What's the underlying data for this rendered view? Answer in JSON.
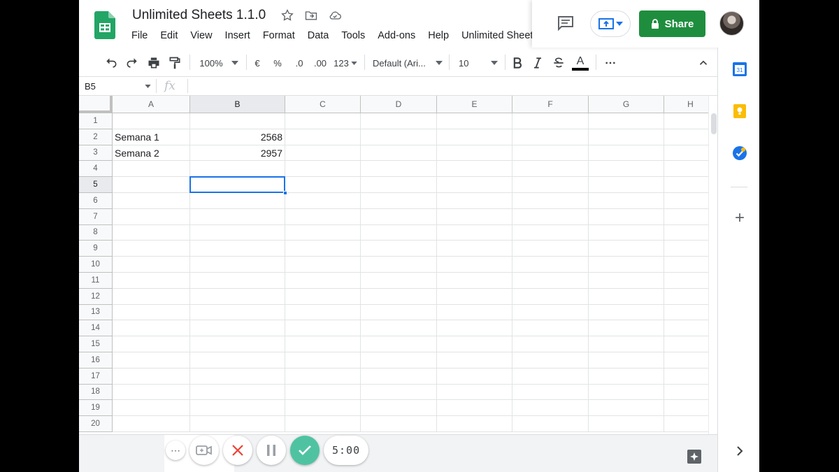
{
  "app": {
    "title": "Unlimited Sheets 1.1.0"
  },
  "menu": [
    "File",
    "Edit",
    "View",
    "Insert",
    "Format",
    "Data",
    "Tools",
    "Add-ons",
    "Help",
    "Unlimited Sheet"
  ],
  "header": {
    "share_label": "Share"
  },
  "toolbar": {
    "zoom": "100%",
    "currency": "€",
    "percent": "%",
    "dec_less": ".0",
    "dec_more": ".00",
    "more_formats": "123",
    "font": "Default (Ari...",
    "font_size": "10",
    "text_color_letter": "A",
    "more": "⋯"
  },
  "formula_bar": {
    "name_box": "B5",
    "fx": "fx"
  },
  "grid": {
    "columns": [
      "A",
      "B",
      "C",
      "D",
      "E",
      "F",
      "G",
      "H"
    ],
    "rows": [
      "1",
      "2",
      "3",
      "4",
      "5",
      "6",
      "7",
      "8",
      "9",
      "10",
      "11",
      "12",
      "13",
      "14",
      "15",
      "16",
      "17",
      "18",
      "19",
      "20"
    ],
    "cells": {
      "A2": "Semana 1",
      "B2": "2568",
      "A3": "Semana 2",
      "B3": "2957"
    },
    "selected": "B5"
  },
  "recorder": {
    "time": "5:00",
    "menu": "⋯"
  },
  "side_panel": {
    "calendar_day": "31",
    "add": "+"
  },
  "colors": {
    "accent": "#1a73e8",
    "share": "#1e8e3e",
    "recorder_ok": "#4fc3a1"
  }
}
